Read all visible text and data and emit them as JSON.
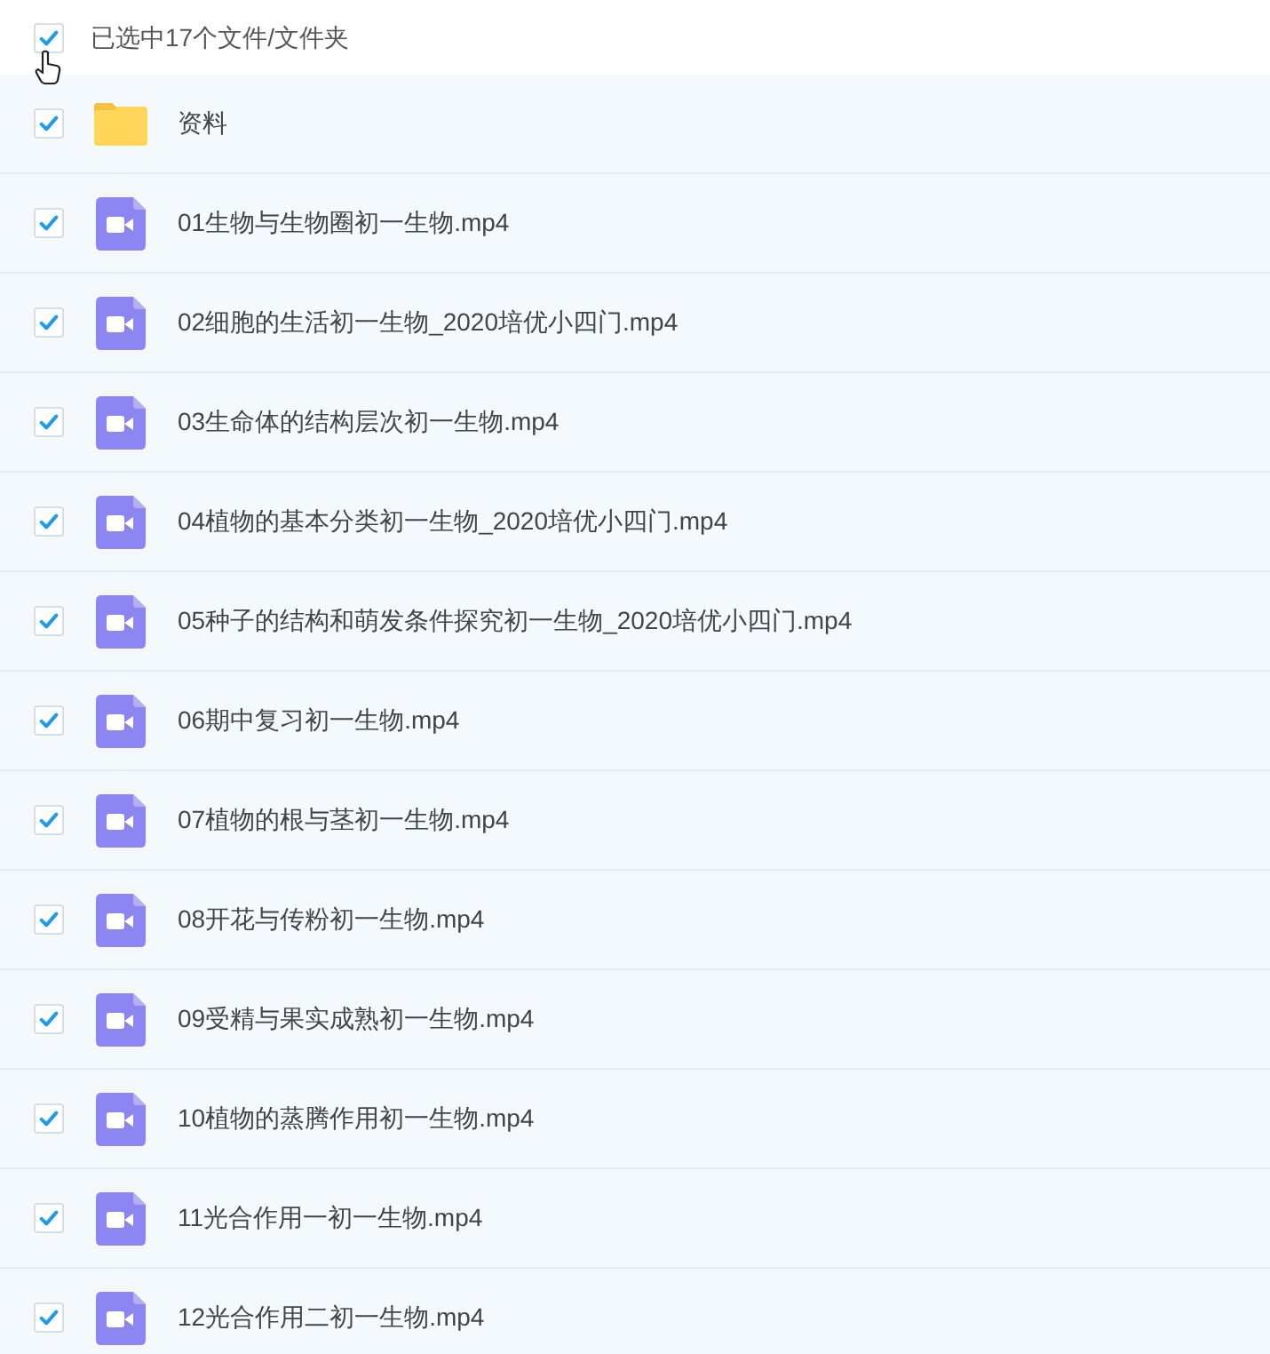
{
  "header": {
    "checked": true,
    "label": "已选中17个文件/文件夹"
  },
  "items": [
    {
      "kind": "folder",
      "name": "资料",
      "checked": true
    },
    {
      "kind": "video",
      "name": "01生物与生物圈初一生物.mp4",
      "checked": true
    },
    {
      "kind": "video",
      "name": "02细胞的生活初一生物_2020培优小四门.mp4",
      "checked": true
    },
    {
      "kind": "video",
      "name": "03生命体的结构层次初一生物.mp4",
      "checked": true
    },
    {
      "kind": "video",
      "name": "04植物的基本分类初一生物_2020培优小四门.mp4",
      "checked": true
    },
    {
      "kind": "video",
      "name": "05种子的结构和萌发条件探究初一生物_2020培优小四门.mp4",
      "checked": true
    },
    {
      "kind": "video",
      "name": "06期中复习初一生物.mp4",
      "checked": true
    },
    {
      "kind": "video",
      "name": "07植物的根与茎初一生物.mp4",
      "checked": true
    },
    {
      "kind": "video",
      "name": "08开花与传粉初一生物.mp4",
      "checked": true
    },
    {
      "kind": "video",
      "name": "09受精与果实成熟初一生物.mp4",
      "checked": true
    },
    {
      "kind": "video",
      "name": "10植物的蒸腾作用初一生物.mp4",
      "checked": true
    },
    {
      "kind": "video",
      "name": "11光合作用一初一生物.mp4",
      "checked": true
    },
    {
      "kind": "video",
      "name": "12光合作用二初一生物.mp4",
      "checked": true
    }
  ]
}
